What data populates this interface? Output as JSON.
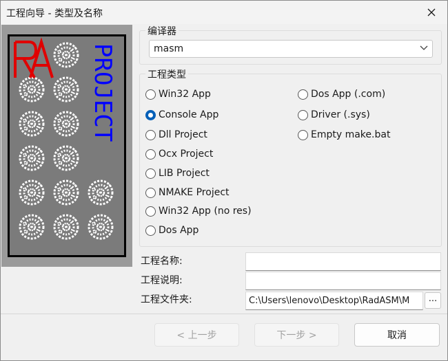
{
  "window": {
    "title": "工程向导 - 类型及名称"
  },
  "logo": {
    "letters": "RA",
    "vertical_text": "PROJECT",
    "accent_red": "#e00000",
    "accent_blue": "#0000ff"
  },
  "assembler_group": {
    "legend": "编译器",
    "selected": "masm"
  },
  "project_type_group": {
    "legend": "工程类型",
    "options_left": [
      {
        "label": "Win32 App",
        "checked": false
      },
      {
        "label": "Console App",
        "checked": true
      },
      {
        "label": "Dll Project",
        "checked": false
      },
      {
        "label": "Ocx Project",
        "checked": false
      },
      {
        "label": "LIB Project",
        "checked": false
      },
      {
        "label": "NMAKE Project",
        "checked": false
      },
      {
        "label": "Win32 App (no res)",
        "checked": false
      },
      {
        "label": "Dos App",
        "checked": false
      }
    ],
    "options_right": [
      {
        "label": "Dos App (.com)",
        "checked": false
      },
      {
        "label": "Driver (.sys)",
        "checked": false
      },
      {
        "label": "Empty make.bat",
        "checked": false
      }
    ]
  },
  "fields": {
    "name_label": "工程名称:",
    "name_value": "",
    "desc_label": "工程说明:",
    "desc_value": "",
    "folder_label": "工程文件夹:",
    "folder_value": "C:\\Users\\lenovo\\Desktop\\RadASM\\M",
    "browse_label": "..."
  },
  "buttons": {
    "back": "< 上一步",
    "next": "下一步 >",
    "cancel": "取消"
  },
  "colors": {
    "radio_checked": "#005fb8"
  }
}
